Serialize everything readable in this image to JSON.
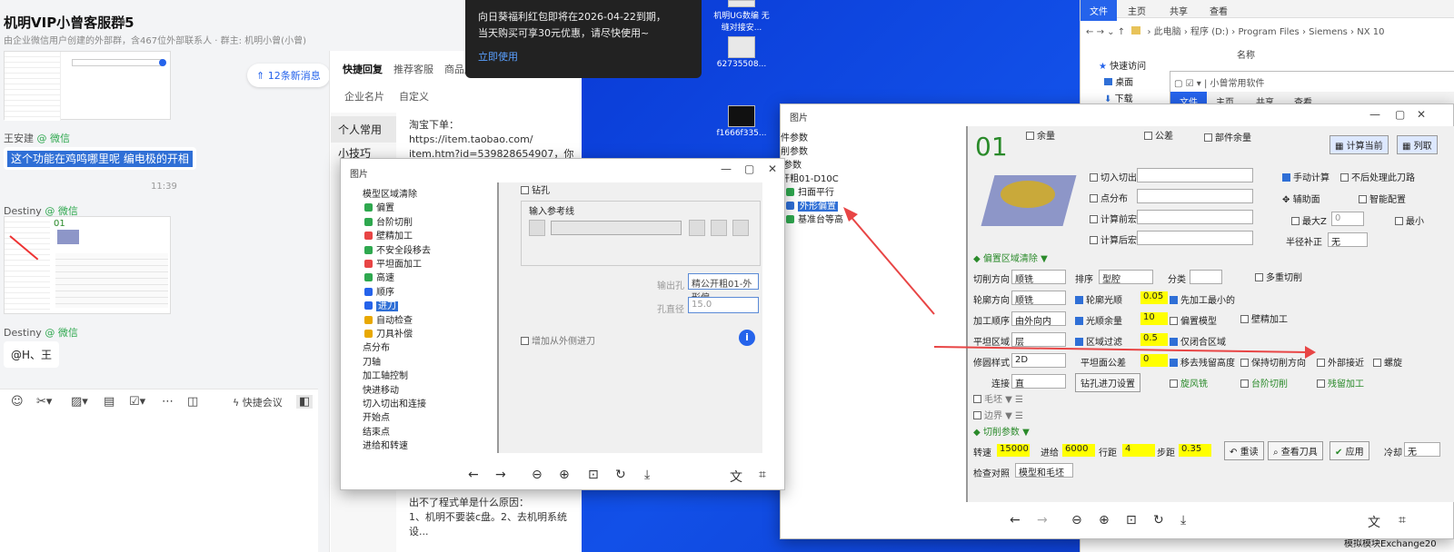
{
  "chat": {
    "title": "机明VIP小曾客服群5",
    "subtitle": "由企业微信用户创建的外部群，含467位外部联系人 · 群主: 机明小曾(小曾)",
    "new_badge": "12条新消息",
    "messages": [
      {
        "sender": "王安建",
        "tag": "@ 微信",
        "text": "这个功能在鸡鸣哪里呢  编电极的开相"
      },
      {
        "time": "11:39"
      },
      {
        "sender": "Destiny",
        "tag": "@ 微信"
      },
      {
        "sender": "Destiny",
        "tag": "@ 微信",
        "text": "@H、王"
      }
    ],
    "toolbar": {
      "meeting": "快捷会议"
    }
  },
  "quick": {
    "tabs": [
      "快捷回复",
      "推荐客服",
      "商品库"
    ],
    "subtabs": [
      "企业名片",
      "自定义"
    ],
    "nav": [
      "个人常用",
      "小技巧"
    ],
    "texts": [
      "淘宝下单：https://item.taobao.com/",
      "item.htm?id=539828654907，你拍...",
      "出不了程式单是什么原因：",
      "1、机明不要装c盘。2、去机明系统设..."
    ]
  },
  "notice": {
    "line1": "向日葵福利红包即将在2026-04-22到期，",
    "line2": "当天购买可享30元优惠，请尽快使用~",
    "link": "立即使用"
  },
  "viewer1": {
    "title": "图片",
    "tree": [
      "模型区域清除",
      "偏置",
      "台阶切削",
      "壁精加工",
      "不安全段移去",
      "平坦面加工",
      "高速",
      "顺序",
      "进刀",
      "自动检查",
      "刀具补偿",
      "点分布",
      "刀轴",
      "加工轴控制",
      "快进移动",
      "切入切出和连接",
      "开始点",
      "结束点",
      "进给和转速"
    ],
    "drill": "钻孔",
    "ref_line": "输入参考线",
    "output_label": "输出孔",
    "output_value": "精公开粗01-外形偏",
    "dia_label": "孔直径",
    "dia_value": "15.0",
    "add_outer": "增加从外侧进刀"
  },
  "viewer2": {
    "title": "图片",
    "tree": [
      "件参数",
      "削参数",
      "I参数",
      "开粗01-D10C",
      "扫面平行",
      "外形偏置",
      "基准台等高"
    ]
  },
  "nx": {
    "big": "01",
    "top_checks": [
      "余量",
      "公差",
      "部件余量"
    ],
    "calc_cur": "计算当前",
    "list_btn": "列取",
    "rows1": [
      "切入切出",
      "点分布",
      "计算前宏",
      "计算后宏"
    ],
    "manual": "手动计算",
    "no_after": "不后处理此刀路",
    "assist": "辅助面",
    "smart": "智能配置",
    "maxz": "最大Z",
    "maxz_val": "0",
    "min_label": "最小",
    "radius": "半径补正",
    "radius_val": "无",
    "offset_clear": "偏置区域清除",
    "cut_dir": "切削方向",
    "cut_dir_val": "顺铣",
    "sort": "排序",
    "sort_val": "型腔",
    "classify": "分类",
    "multi": "多重切削",
    "contour_dir": "轮廓方向",
    "contour_dir_val": "顺铣",
    "contour_smooth": "轮廓光顺",
    "contour_smooth_val": "0.05",
    "min_first": "先加工最小的",
    "order": "加工顺序",
    "order_val": "由外向内",
    "smooth_rest": "光顺余量",
    "smooth_rest_val": "10",
    "offset_model": "偏置模型",
    "wall_finish": "壁精加工",
    "flat": "平坦区域",
    "flat_val": "层",
    "region_filter": "区域过滤",
    "region_filter_val": "0.5",
    "closed_only": "仅闭合区域",
    "trim": "修圆样式",
    "trim_val": "2D",
    "flat_tol": "平坦面公差",
    "flat_tol_val": "0",
    "remove_peak": "移去残留高度",
    "keep_dir": "保持切削方向",
    "outer_approach": "外部接近",
    "spiral": "螺旋",
    "connect": "连接",
    "connect_val": "直",
    "drill_set": "钻孔进刀设置",
    "whirl": "旋风铣",
    "step_cut": "台阶切削",
    "rest": "残留加工",
    "blank": "毛坯",
    "border": "边界",
    "cut_params": "切削参数",
    "speed": "转速",
    "speed_val": "15000",
    "feed": "进给",
    "feed_val": "6000",
    "pitch": "行距",
    "pitch_val": "4",
    "step": "步距",
    "step_val": "0.35",
    "reread": "重读",
    "view_tool": "查看刀具",
    "apply": "应用",
    "coolant": "冷却",
    "coolant_val": "无",
    "check": "检查对照",
    "check_val": "模型和毛坯"
  },
  "explorer": {
    "tabs": [
      "文件",
      "主页",
      "共享",
      "查看"
    ],
    "path": [
      "此电脑",
      "程序 (D:)",
      "Program Files",
      "Siemens",
      "NX 10"
    ],
    "col": "名称",
    "nav": [
      "快速访问",
      "桌面",
      "下载"
    ],
    "sub_title": "小曾常用软件",
    "sub_tabs": [
      "文件",
      "主页",
      "共享",
      "查看"
    ],
    "bottom": "模拟模块Exchange20"
  },
  "desktop": {
    "icons": [
      "机明UG数编 无缝对接安...",
      "62735508...",
      "f1666f335..."
    ]
  },
  "colors": {
    "accent": "#2563eb",
    "wechat": "#2fa84f",
    "yellow": "#ffff00"
  }
}
